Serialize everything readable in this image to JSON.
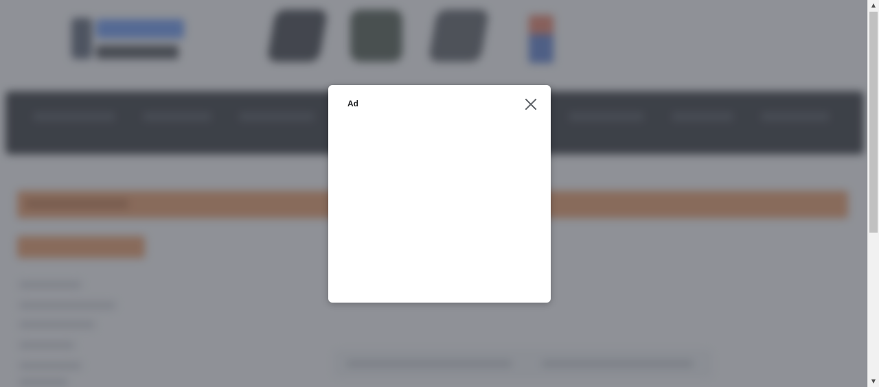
{
  "modal": {
    "title": "Ad",
    "close_icon": "close-icon"
  },
  "background": {
    "logo": "site-logo",
    "promo_icons": [
      "app-promo-icon-1",
      "app-promo-icon-2",
      "app-promo-icon-3"
    ],
    "flag_icon": "language-flag-icon",
    "colors": {
      "nav_bar": "#1e2228",
      "banner": "#e3905a",
      "overlay": "rgba(80,84,92,0.62)"
    }
  },
  "scrollbar": {
    "up_arrow": "▲",
    "down_arrow": "▼"
  }
}
